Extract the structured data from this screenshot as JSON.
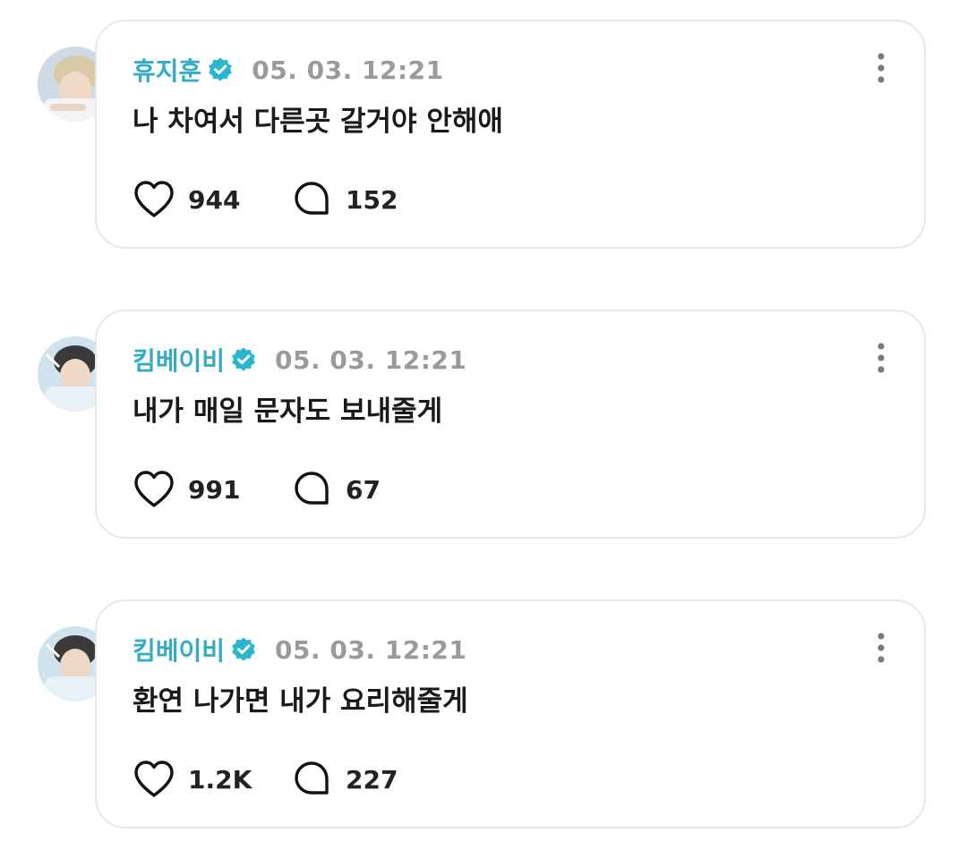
{
  "posts": [
    {
      "username": "휴지훈",
      "timestamp": "05. 03. 12:21",
      "text": "나 차여서 다른곳 갈거야  안해애",
      "likes": "944",
      "comments": "152"
    },
    {
      "username": "킴베이비",
      "timestamp": "05. 03. 12:21",
      "text": "내가 매일 문자도 보내줄게",
      "likes": "991",
      "comments": "67"
    },
    {
      "username": "킴베이비",
      "timestamp": "05. 03. 12:21",
      "text": "환연 나가면 내가 요리해줄게",
      "likes": "1.2K",
      "comments": "227"
    }
  ],
  "colors": {
    "username": "#36abc6",
    "verified_badge": "#2bb6cf",
    "timestamp": "#9a9a9a",
    "card_border": "#e7e7e7"
  },
  "icons": {
    "verified": "verified-badge-icon",
    "more": "more-vertical-icon",
    "like": "heart-icon",
    "comment": "speech-bubble-icon"
  }
}
